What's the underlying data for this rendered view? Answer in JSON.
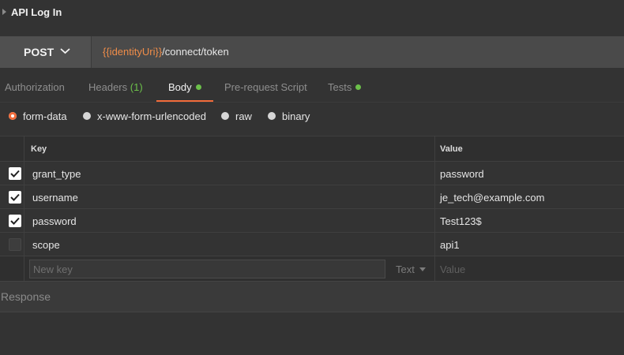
{
  "request": {
    "title": "API Log In"
  },
  "urlbar": {
    "method": "POST",
    "url_variable": "{{identityUri}}",
    "url_path": "/connect/token"
  },
  "tabs": [
    {
      "label": "Authorization"
    },
    {
      "label": "Headers",
      "count": "(1)"
    },
    {
      "label": "Body",
      "active": true
    },
    {
      "label": "Pre-request Script"
    },
    {
      "label": "Tests"
    }
  ],
  "body_types": [
    {
      "label": "form-data",
      "selected": true
    },
    {
      "label": "x-www-form-urlencoded"
    },
    {
      "label": "raw"
    },
    {
      "label": "binary"
    }
  ],
  "kv_table": {
    "key_header": "Key",
    "value_header": "Value",
    "rows": [
      {
        "key": "grant_type",
        "value": "password",
        "checked": true
      },
      {
        "key": "username",
        "value": "je_tech@example.com",
        "checked": true
      },
      {
        "key": "password",
        "value": "Test123$",
        "checked": true
      },
      {
        "key": "scope",
        "value": "api1",
        "checked": false
      }
    ],
    "new_key_placeholder": "New key",
    "new_type": "Text",
    "new_value_placeholder": "Value"
  },
  "response": {
    "label": "Response"
  },
  "colors": {
    "accent": "#f26b3a",
    "indicator": "#6cc04a",
    "url_variable": "#f08d49"
  },
  "icons": {
    "method_dropdown": "chevron-down-icon",
    "collapse": "caret-right-icon",
    "checkbox": "check-icon"
  }
}
